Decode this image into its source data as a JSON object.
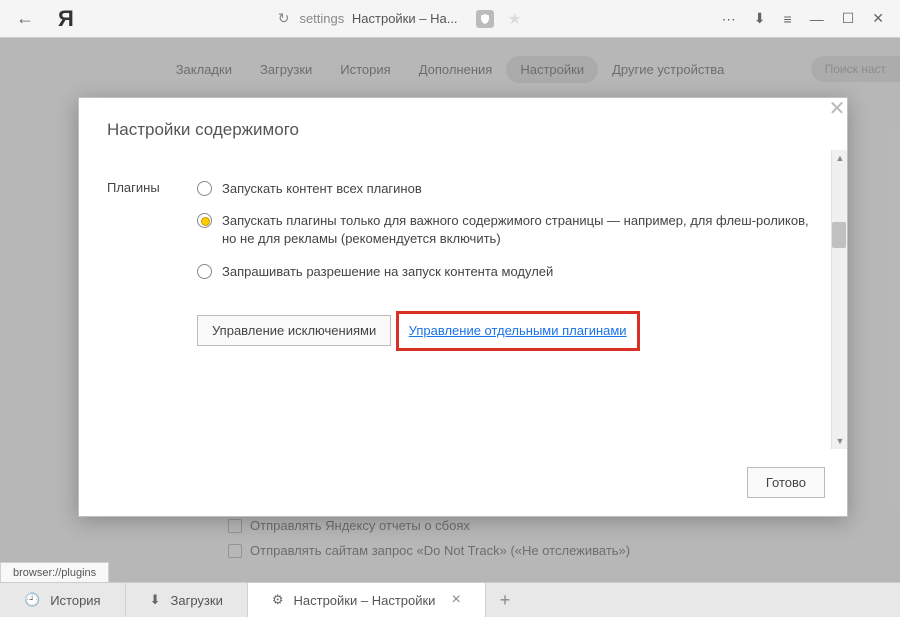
{
  "titlebar": {
    "address_path": "settings",
    "address_title": "Настройки – На..."
  },
  "bg": {
    "tabs": [
      "Закладки",
      "Загрузки",
      "История",
      "Дополнения",
      "Настройки",
      "Другие устройства"
    ],
    "search_placeholder": "Поиск наст",
    "chk1": "Отправлять Яндексу отчеты о сбоях",
    "chk2": "Отправлять сайтам запрос «Do Not Track» («Не отслеживать»)"
  },
  "modal": {
    "title": "Настройки содержимого",
    "section": "Плагины",
    "opt1": "Запускать контент всех плагинов",
    "opt2": "Запускать плагины только для важного содержимого страницы — например, для флеш-роликов, но не для рекламы (рекомендуется включить)",
    "opt3": "Запрашивать разрешение на запуск контента модулей",
    "manage_btn": "Управление исключениями",
    "link": "Управление отдельными плагинами",
    "done": "Готово"
  },
  "status": "browser://plugins",
  "bottom_tabs": {
    "history": "История",
    "downloads": "Загрузки",
    "settings": "Настройки – Настройки"
  }
}
